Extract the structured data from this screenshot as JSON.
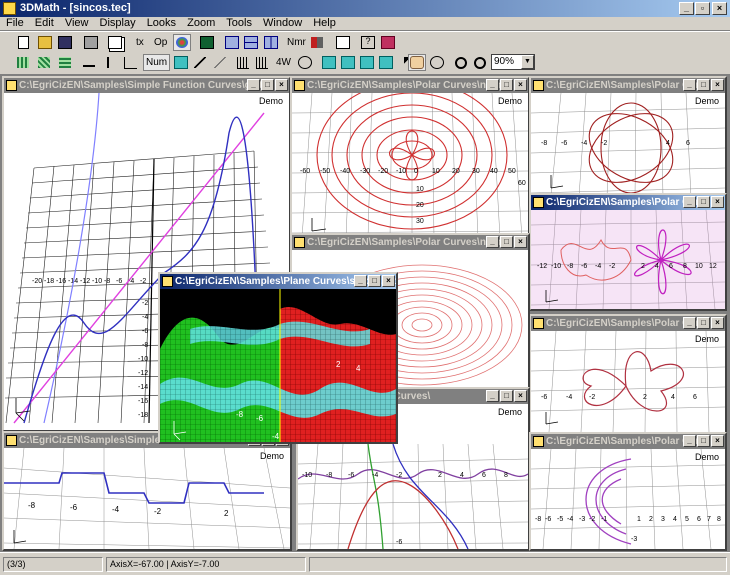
{
  "app": {
    "title": "3DMath - [sincos.tec]"
  },
  "window_controls": {
    "minimize": "_",
    "restore": "▫",
    "close": "×"
  },
  "menu": [
    "File",
    "Edit",
    "View",
    "Display",
    "Looks",
    "Zoom",
    "Tools",
    "Window",
    "Help"
  ],
  "toolbar": {
    "tx_label": "tx",
    "op_label": "Op",
    "num_label": "Num",
    "w4_label": "4W",
    "nmr_label": "Nmr",
    "zoom_value": "90%"
  },
  "windows": {
    "simple_function_1": {
      "title": "C:\\EgriCizEN\\Samples\\Simple Function Curves\\g1.tec",
      "demo": "Demo"
    },
    "polar_n6": {
      "title": "C:\\EgriCizEN\\Samples\\Polar Curves\\n6.tec",
      "demo": "Demo"
    },
    "polar_top_right": {
      "title": "C:\\EgriCizEN\\Samples\\Polar Curves\\",
      "demo": "Demo"
    },
    "polar_pink": {
      "title": "C:\\EgriCizEN\\Samples\\Polar Curves\\",
      "demo": "Demo"
    },
    "polar_n3": {
      "title": "C:\\EgriCizEN\\Samples\\Polar Curves\\n3.tec",
      "demo": "Demo"
    },
    "polar_mid_right": {
      "title": "C:\\EgriCizEN\\Samples\\Polar Curves\\",
      "demo": "Demo"
    },
    "simple_function_2": {
      "title": "C:\\EgriCizEN\\Samples\\Simple Function Curves\\",
      "demo": "Demo"
    },
    "simple_function_3": {
      "title": "Simple Function Curves\\",
      "demo": "Demo"
    },
    "polar_bottom_right": {
      "title": "C:\\EgriCizEN\\Samples\\Polar Curves\\",
      "demo": "Demo"
    },
    "plane_sincos": {
      "title": "C:\\EgriCizEN\\Samples\\Plane Curves\\sincos.tec"
    }
  },
  "axis_labels": {
    "g1_x": [
      "-20",
      "-18",
      "-16",
      "-14",
      "-12",
      "-10",
      "-8",
      "-6",
      "-4",
      "-2",
      "2",
      "4",
      "6",
      "8",
      "10",
      "12",
      "14",
      "16"
    ],
    "g1_y": [
      "-2",
      "-4",
      "-6",
      "-8",
      "-10",
      "-12",
      "-14",
      "-16",
      "-18",
      "-20"
    ],
    "n6_x": [
      "-60",
      "-50",
      "-40",
      "-30",
      "-20",
      "-10",
      "0",
      "10",
      "20",
      "30",
      "40",
      "50",
      "60"
    ],
    "n6_y": [
      "10",
      "20",
      "30"
    ],
    "pink_x": [
      "-12",
      "-10",
      "-8",
      "-6",
      "-4",
      "-2",
      "2",
      "4",
      "6",
      "8",
      "10",
      "12"
    ],
    "small_ticks": [
      "-6",
      "-4",
      "-2",
      "2",
      "4",
      "6"
    ],
    "sf2_x": [
      "-8",
      "-6",
      "-4",
      "-2",
      "2"
    ],
    "sf3_x": [
      "-10",
      "-8",
      "-6",
      "-4",
      "-2",
      "2",
      "4",
      "6",
      "8"
    ],
    "br_x": [
      "-8",
      "-6",
      "-5",
      "-4",
      "-3",
      "-2",
      "-1",
      "1",
      "2",
      "3",
      "4",
      "5",
      "6",
      "7",
      "8"
    ],
    "sincos_labels": [
      "-8",
      "-6",
      "-4",
      "-2",
      "2",
      "4"
    ]
  },
  "status": {
    "pages": "(3/3)",
    "coords": "AxisX=-67.00 | AxisY=-7.00"
  }
}
